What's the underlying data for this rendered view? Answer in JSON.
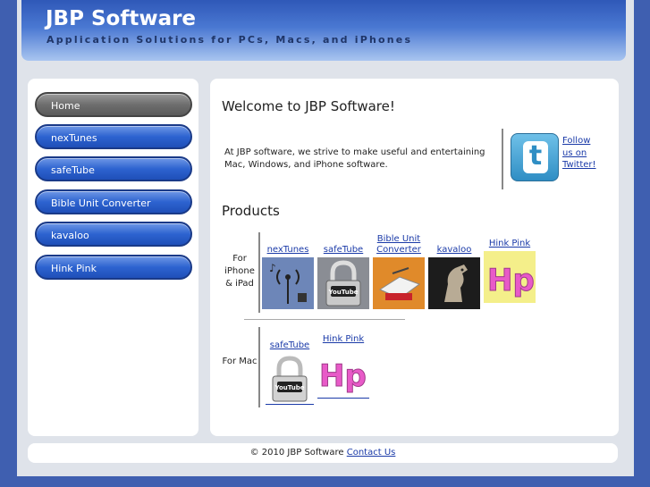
{
  "header": {
    "title": "JBP Software",
    "tagline": "Application Solutions for PCs, Macs, and iPhones"
  },
  "sidebar": {
    "items": [
      {
        "label": "Home"
      },
      {
        "label": "nexTunes"
      },
      {
        "label": "safeTube"
      },
      {
        "label": "Bible Unit Converter"
      },
      {
        "label": "kavaloo"
      },
      {
        "label": "Hink Pink"
      }
    ]
  },
  "main": {
    "welcome_heading": "Welcome to JBP Software!",
    "intro": "At JBP software, we strive to make useful and entertaining Mac, Windows, and iPhone software.",
    "twitter_link": "Follow us on Twitter!",
    "products_heading": "Products",
    "iphone": {
      "label": "For iPhone & iPad",
      "products": [
        {
          "label": "nexTunes"
        },
        {
          "label": "safeTube"
        },
        {
          "label": "Bible Unit Converter"
        },
        {
          "label": "kavaloo"
        },
        {
          "label": "Hink Pink"
        }
      ]
    },
    "mac": {
      "label": "For Mac",
      "products": [
        {
          "label": "safeTube"
        },
        {
          "label": "Hink Pink"
        }
      ]
    }
  },
  "footer": {
    "copyright": "© 2010 JBP Software",
    "contact": "Contact Us"
  },
  "colors": {
    "background": "#3f5fb0",
    "nav_button": "#2d63d0",
    "nav_active": "#6e6e6e",
    "link": "#1a3aa8"
  },
  "icons": [
    "twitter-icon",
    "nextunes-icon",
    "safetube-lock-icon",
    "bible-unit-converter-icon",
    "kavaloo-horse-icon",
    "hink-pink-icon"
  ]
}
